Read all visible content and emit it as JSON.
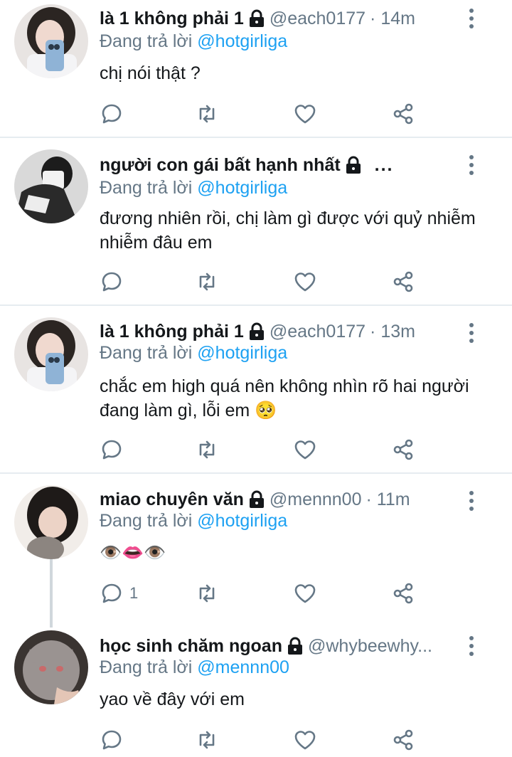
{
  "tweets": [
    {
      "name": "là 1 không phải 1",
      "handle": "@each0177",
      "time": "· 14m",
      "replying_label": "Đang trả lời",
      "replying_to": "@hotgirliga",
      "text": "chị nói thật ?",
      "reply_count": ""
    },
    {
      "name": "người con gái bất hạnh nhất",
      "handle": "",
      "time": "",
      "more": "...",
      "replying_label": "Đang trả lời",
      "replying_to": "@hotgirliga",
      "text": "đương nhiên rồi, chị làm gì được với quỷ nhiễm nhiễm đâu em",
      "reply_count": ""
    },
    {
      "name": "là 1 không phải 1",
      "handle": "@each0177",
      "time": "· 13m",
      "replying_label": "Đang trả lời",
      "replying_to": "@hotgirliga",
      "text": "chắc em high quá nên không nhìn rõ hai người đang làm gì, lỗi em 🥺",
      "reply_count": ""
    },
    {
      "name": "miao chuyên văn",
      "handle": "@mennn00",
      "time": "· 11m",
      "replying_label": "Đang trả lời",
      "replying_to": "@hotgirliga",
      "text": "👁️👄👁️",
      "reply_count": "1"
    },
    {
      "name": "học sinh chăm ngoan",
      "handle": "@whybeewhy...",
      "time": "",
      "replying_label": "Đang trả lời",
      "replying_to": "@mennn00",
      "text": "yao về đây với em",
      "reply_count": ""
    }
  ],
  "icons": {
    "reply": "reply-icon",
    "retweet": "retweet-icon",
    "like": "heart-icon",
    "share": "share-icon",
    "lock": "lock-icon",
    "menu": "more-vertical-icon"
  },
  "colors": {
    "link": "#1da1f2",
    "secondary": "#657786",
    "divider": "#e6ecf0"
  }
}
